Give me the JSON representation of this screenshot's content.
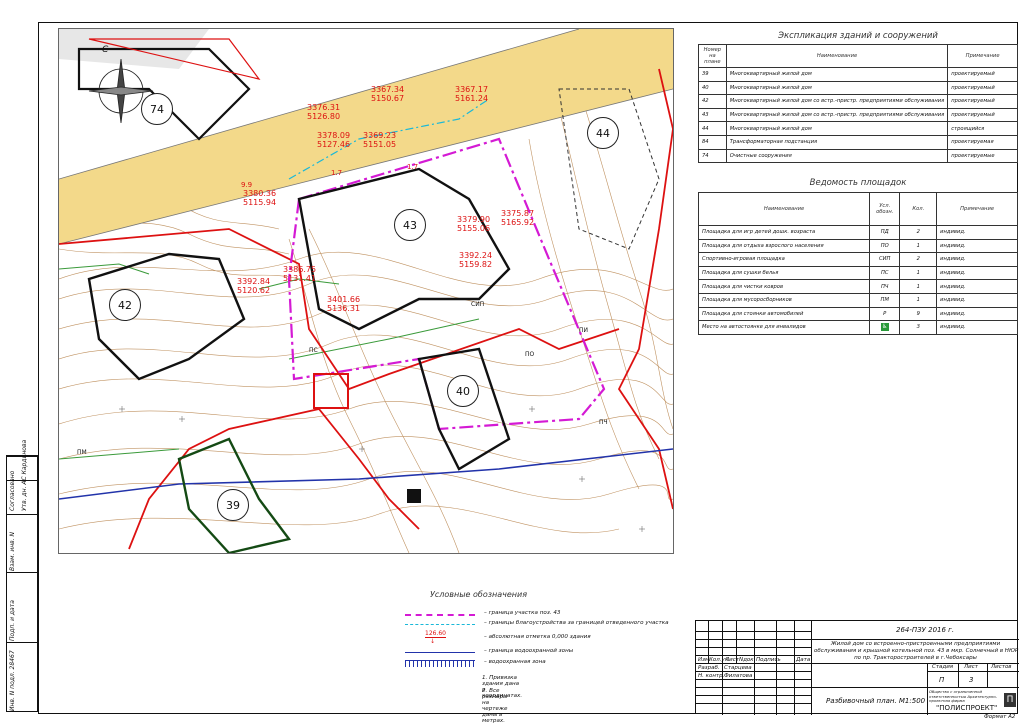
{
  "sidebar": {
    "labels": [
      "Согласовано",
      "Утв. дн. АС Кардинова",
      "Взам. инв. N",
      "Подп. и дата",
      "Инв. N подл. 28467"
    ]
  },
  "plan": {
    "north_label": "С",
    "buildings": [
      "74",
      "43",
      "42",
      "40",
      "39",
      "44"
    ],
    "zone_labels": [
      "ПО",
      "ПИ",
      "ПС",
      "СИП",
      "ПЧ",
      "ПМ"
    ],
    "coords": [
      {
        "a": "3376.31",
        "b": "5126.80"
      },
      {
        "a": "3367.34",
        "b": "5150.67"
      },
      {
        "a": "3378.09",
        "b": "5127.46"
      },
      {
        "a": "3369.23",
        "b": "5151.05"
      },
      {
        "a": "3380.36",
        "b": "5115.94"
      },
      {
        "a": "3379.90",
        "b": "5155.06"
      },
      {
        "a": "3375.87",
        "b": "5165.92"
      },
      {
        "a": "3386.75",
        "b": "5131.41"
      },
      {
        "a": "3392.24",
        "b": "5159.82"
      },
      {
        "a": "3392.84",
        "b": "5120.62"
      },
      {
        "a": "3401.66",
        "b": "5136.31"
      },
      {
        "a": "3367.17",
        "b": "5161.24"
      }
    ],
    "dims": [
      "9.9",
      "1.7",
      "1.7"
    ]
  },
  "explication": {
    "title": "Экспликация зданий и сооружений",
    "headers": [
      "Номер на плане",
      "Наименование",
      "Примечание"
    ],
    "rows": [
      [
        "39",
        "Многоквартирный жилой дом",
        "проектируемый"
      ],
      [
        "40",
        "Многоквартирный жилой дом",
        "проектируемый"
      ],
      [
        "42",
        "Многоквартирный жилой дом со встр.-пристр. предприятиями обслуживания",
        "проектируемый"
      ],
      [
        "43",
        "Многоквартирный жилой дом со встр.-пристр. предприятиями обслуживания",
        "проектируемый"
      ],
      [
        "44",
        "Многоквартирный жилой дом",
        "строящийся"
      ],
      [
        "84",
        "Трансформаторная подстанция",
        "проектируемая"
      ],
      [
        "74",
        "Очистные сооружения",
        "проектируемые"
      ]
    ]
  },
  "areas": {
    "title": "Ведомость площадок",
    "headers": [
      "Наименование",
      "Усл. обозн.",
      "Кол.",
      "Примечание"
    ],
    "rows": [
      [
        "Площадка для игр детей дошк. возраста",
        "ПД",
        "2",
        "индивид."
      ],
      [
        "Площадка для отдыха взрослого населения",
        "ПО",
        "1",
        "индивид."
      ],
      [
        "Спортивно-игровая площадка",
        "СИП",
        "2",
        "индивид."
      ],
      [
        "Площадка для сушки белья",
        "ПС",
        "1",
        "индивид."
      ],
      [
        "Площадка для чистки ковров",
        "ПЧ",
        "1",
        "индивид."
      ],
      [
        "Площадка для мусоросборников",
        "ПМ",
        "1",
        "индивид."
      ],
      [
        "Площадка для стоянки автомобилей",
        "Р",
        "9",
        "индивид."
      ],
      [
        "Место на автостоянке для инвалидов",
        "",
        "3",
        "индивид."
      ]
    ]
  },
  "legend": {
    "title": "Условные обозначения",
    "items": [
      "– граница участка поз. 43",
      "– границы благоустройства за границей отведенного участка",
      "– абсолютная отметка 0,000 здания",
      "– граница водоохранной зоны",
      "– водоохранная зона"
    ],
    "mark": "126.60",
    "notes": [
      "1. Привязка здания дана в координатах.",
      "2. Все размеры на чертеже даны в метрах."
    ]
  },
  "stamp": {
    "code": "264-ПЗУ 2016 г.",
    "description_1": "Жилой дом со встроенно-пристроенными предприятиями",
    "description_2": "обслуживания и крышной котельной поз. 43 в мкр. Солнечный в НЮР",
    "description_3": "по пр. Тракторостроителей в г.Чебоксары",
    "col_headers": [
      "Изм.",
      "Кол.уч.",
      "Лист",
      "Nдок.",
      "Подпись",
      "Дата"
    ],
    "role_1": "Разраб.",
    "name_1": "Старцева",
    "role_2": "Н. контр.",
    "name_2": "Филатова",
    "stage_header": "Стадия",
    "sheet_header": "Лист",
    "sheets_header": "Листов",
    "stage": "П",
    "sheet": "3",
    "sheets": "",
    "drawing_title": "Разбивочный план. М1:500",
    "org_small": "Общество с ограниченной ответственностью Архитектурно-проектная фирма",
    "org_name": "\"ПОЛИСПРОЕКТ\"",
    "format": "Формат А2"
  }
}
